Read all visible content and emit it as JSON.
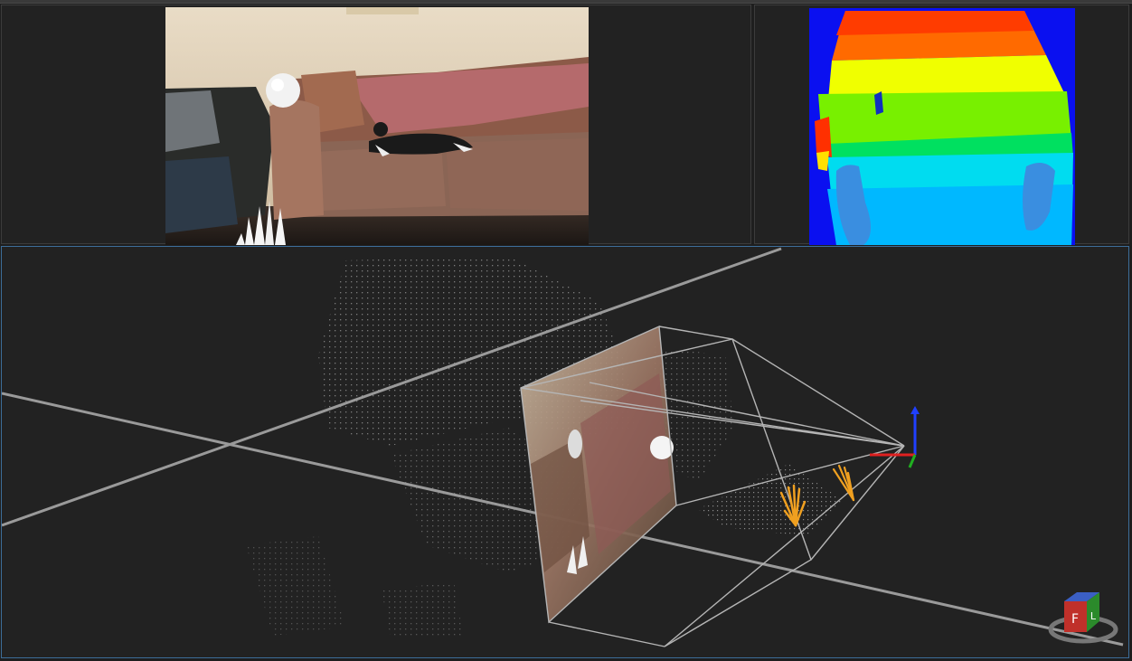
{
  "app": {
    "panels": [
      {
        "id": "camera-view",
        "label": ""
      },
      {
        "id": "depth-view",
        "label": ""
      },
      {
        "id": "scene-3d-view",
        "label": ""
      }
    ]
  },
  "scene": {
    "view_cube": {
      "face_front": "F",
      "face_left": "L",
      "colors": {
        "front": "#c0302a",
        "left": "#2b8a2b",
        "top": "#3b5fc4"
      }
    },
    "axes_colors": {
      "x": "#e02020",
      "y": "#20b020",
      "z": "#2040ff"
    },
    "hand_color": "#f0a020"
  },
  "colors": {
    "background": "#1e1e1e",
    "panel": "#222222",
    "active_border": "#3d6d99"
  }
}
